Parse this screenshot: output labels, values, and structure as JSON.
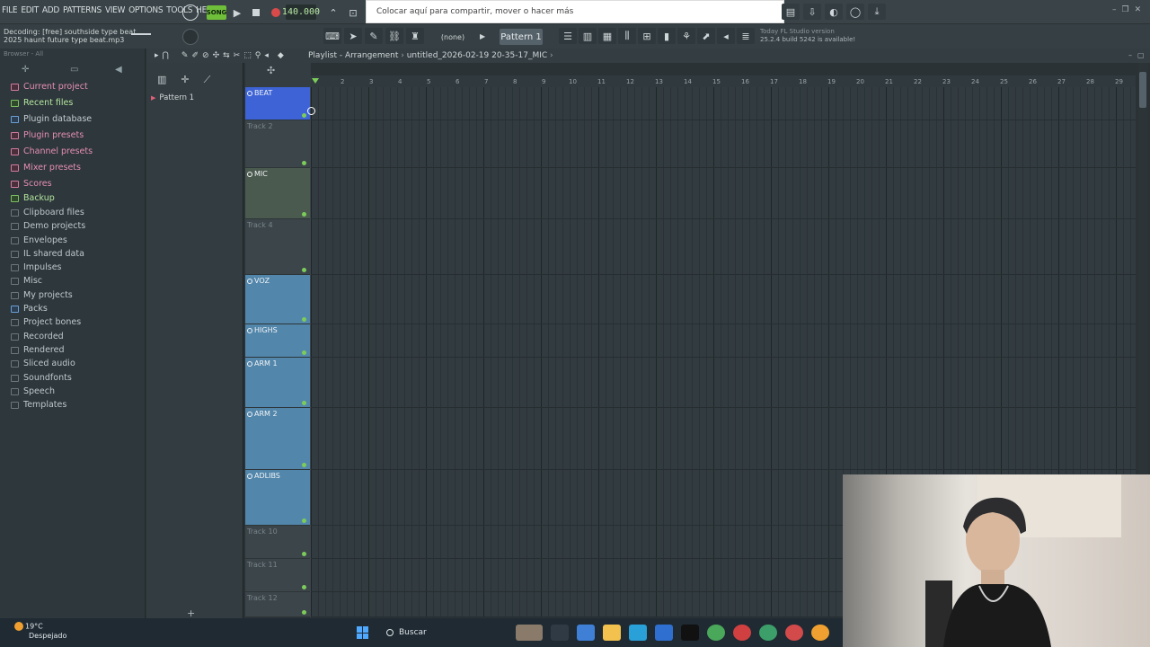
{
  "menu": [
    "FILE",
    "EDIT",
    "ADD",
    "PATTERNS",
    "VIEW",
    "OPTIONS",
    "TOOLS",
    "HELP"
  ],
  "transport": {
    "song_label": "SONG",
    "tempo": "140.000"
  },
  "share_tooltip": "Colocar aquí para compartir, mover o hacer más",
  "decoding": {
    "line1": "Decoding: [free] southside type beat",
    "line2": "2025 haunt future type beat.mp3"
  },
  "toolbar": {
    "none_label": "(none)",
    "pattern_label": "Pattern 1"
  },
  "version_info": {
    "line1": "Today  FL Studio version",
    "line2": "25.2.4 build 5242 is available!"
  },
  "browser": {
    "header": "Browser - All",
    "items": [
      {
        "label": "Current project",
        "kind": "pink"
      },
      {
        "label": "Recent files",
        "kind": "green"
      },
      {
        "label": "Plugin database",
        "kind": "blue"
      },
      {
        "label": "Plugin presets",
        "kind": "pink"
      },
      {
        "label": "Channel presets",
        "kind": "pink"
      },
      {
        "label": "Mixer presets",
        "kind": "pink"
      },
      {
        "label": "Scores",
        "kind": "pink"
      },
      {
        "label": "Backup",
        "kind": "green"
      },
      {
        "label": "Clipboard files",
        "kind": "plain"
      },
      {
        "label": "Demo projects",
        "kind": "plain"
      },
      {
        "label": "Envelopes",
        "kind": "plain"
      },
      {
        "label": "IL shared data",
        "kind": "plain"
      },
      {
        "label": "Impulses",
        "kind": "plain"
      },
      {
        "label": "Misc",
        "kind": "plain"
      },
      {
        "label": "My projects",
        "kind": "plain"
      },
      {
        "label": "Packs",
        "kind": "blue"
      },
      {
        "label": "Project bones",
        "kind": "plain"
      },
      {
        "label": "Recorded",
        "kind": "plain"
      },
      {
        "label": "Rendered",
        "kind": "plain"
      },
      {
        "label": "Sliced audio",
        "kind": "plain"
      },
      {
        "label": "Soundfonts",
        "kind": "plain"
      },
      {
        "label": "Speech",
        "kind": "plain"
      },
      {
        "label": "Templates",
        "kind": "plain"
      }
    ]
  },
  "patterns": [
    "Pattern 1"
  ],
  "playlist": {
    "title": "Playlist - Arrangement",
    "file": "untitled_2026-02-19 20-35-17_MIC",
    "bars": [
      "2",
      "3",
      "4",
      "5",
      "6",
      "7",
      "8",
      "9",
      "10",
      "11",
      "12",
      "13",
      "14",
      "15",
      "16",
      "17",
      "18",
      "19",
      "20",
      "21",
      "22",
      "23",
      "24",
      "25",
      "26",
      "27",
      "28",
      "29"
    ],
    "tracks": [
      {
        "name": "BEAT",
        "color": "#3d63d6",
        "empty": false
      },
      {
        "name": "Track 2",
        "color": "#3c454a",
        "empty": true
      },
      {
        "name": "MIC",
        "color": "#4a5a4f",
        "empty": false
      },
      {
        "name": "Track 4",
        "color": "#3c454a",
        "empty": true
      },
      {
        "name": "VOZ",
        "color": "#5286ab",
        "empty": false
      },
      {
        "name": "HIGHS",
        "color": "#5286ab",
        "empty": false
      },
      {
        "name": "ARM 1",
        "color": "#5286ab",
        "empty": false
      },
      {
        "name": "ARM 2",
        "color": "#5286ab",
        "empty": false
      },
      {
        "name": "ADLIBS",
        "color": "#5286ab",
        "empty": false
      },
      {
        "name": "Track 10",
        "color": "#3c454a",
        "empty": true
      },
      {
        "name": "Track 11",
        "color": "#3c454a",
        "empty": true
      },
      {
        "name": "Track 12",
        "color": "#3c454a",
        "empty": true
      }
    ]
  },
  "taskbar": {
    "weather_temp": "19°C",
    "weather_desc": "Despejado",
    "search_placeholder": "Buscar"
  }
}
